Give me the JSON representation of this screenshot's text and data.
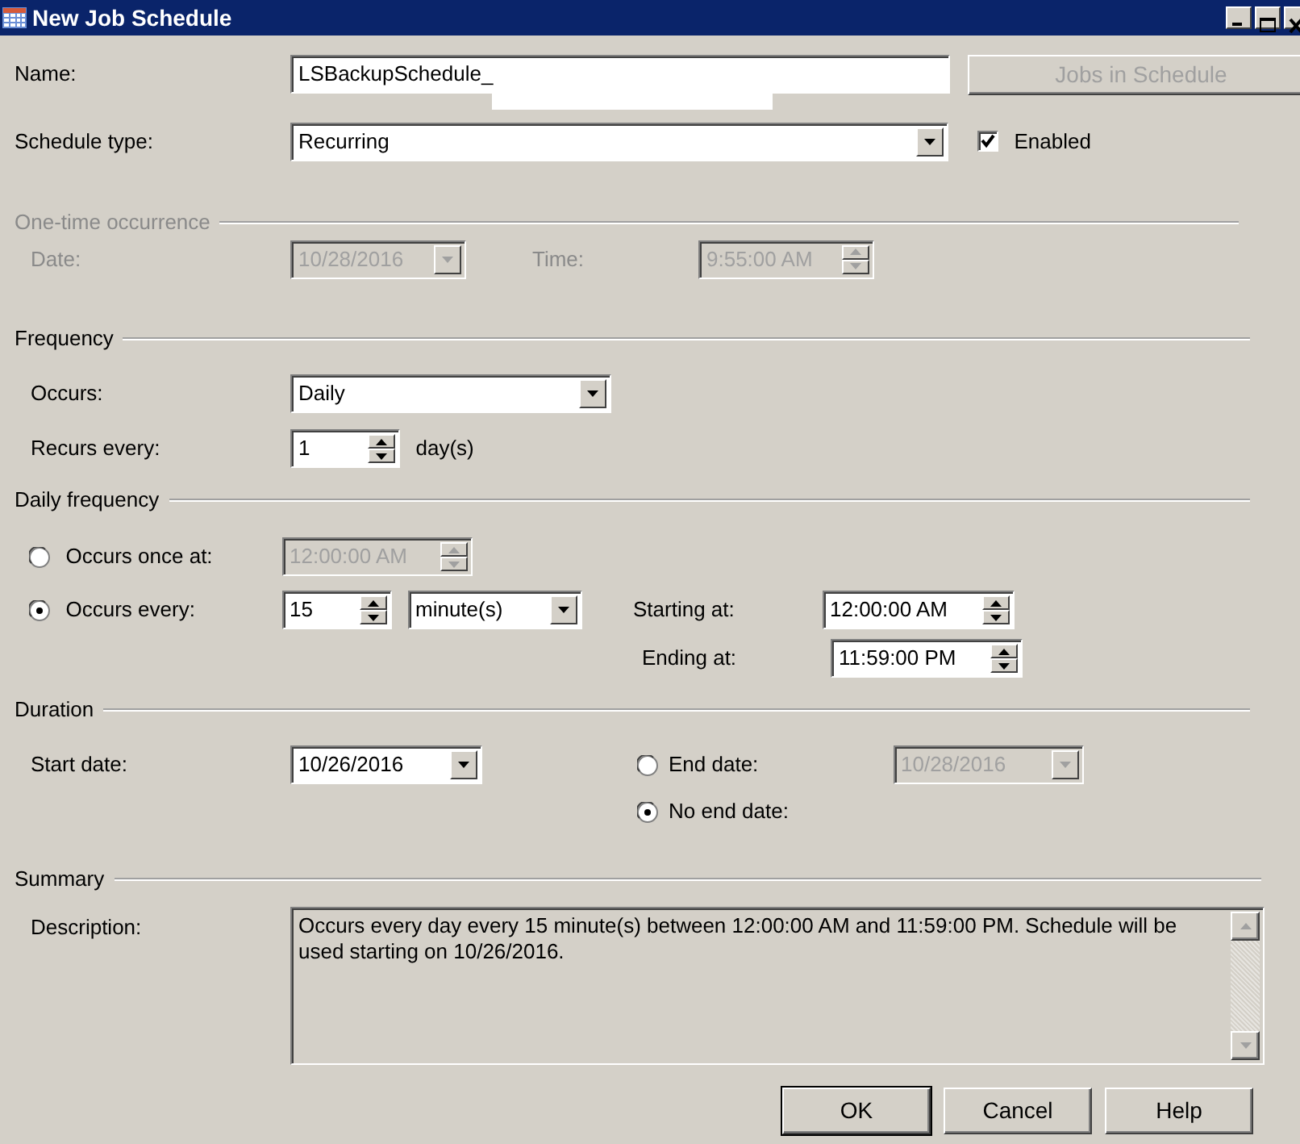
{
  "window": {
    "title": "New Job Schedule"
  },
  "name": {
    "label": "Name:",
    "value": "LSBackupSchedule_"
  },
  "jobs_button": {
    "label": "Jobs in Schedule",
    "disabled": true
  },
  "schedule_type": {
    "label": "Schedule type:",
    "value": "Recurring"
  },
  "enabled": {
    "label": "Enabled",
    "checked": true
  },
  "one_time": {
    "title": "One-time occurrence",
    "disabled": true,
    "date_label": "Date:",
    "date": "10/28/2016",
    "time_label": "Time:",
    "time": "9:55:00 AM"
  },
  "frequency": {
    "title": "Frequency",
    "occurs_label": "Occurs:",
    "occurs": "Daily",
    "recurs_label": "Recurs every:",
    "recurs": "1",
    "recurs_unit": "day(s)"
  },
  "daily_frequency": {
    "title": "Daily frequency",
    "options": [
      {
        "label": "Occurs once at:",
        "selected": false,
        "time": "12:00:00 AM"
      },
      {
        "label": "Occurs every:",
        "selected": true,
        "interval": "15",
        "unit": "minute(s)"
      }
    ],
    "starting_label": "Starting at:",
    "starting": "12:00:00 AM",
    "ending_label": "Ending at:",
    "ending": "11:59:00 PM"
  },
  "duration": {
    "title": "Duration",
    "start_label": "Start date:",
    "start": "10/26/2016",
    "options": [
      {
        "label": "End date:",
        "selected": false,
        "date": "10/28/2016"
      },
      {
        "label": "No end date:",
        "selected": true
      }
    ]
  },
  "summary": {
    "title": "Summary",
    "description_label": "Description:",
    "description": "Occurs every day every 15 minute(s) between 12:00:00 AM and 11:59:00 PM. Schedule will be used starting on 10/26/2016."
  },
  "buttons": [
    {
      "label": "OK",
      "default": true
    },
    {
      "label": "Cancel",
      "default": false
    },
    {
      "label": "Help",
      "default": false
    }
  ]
}
